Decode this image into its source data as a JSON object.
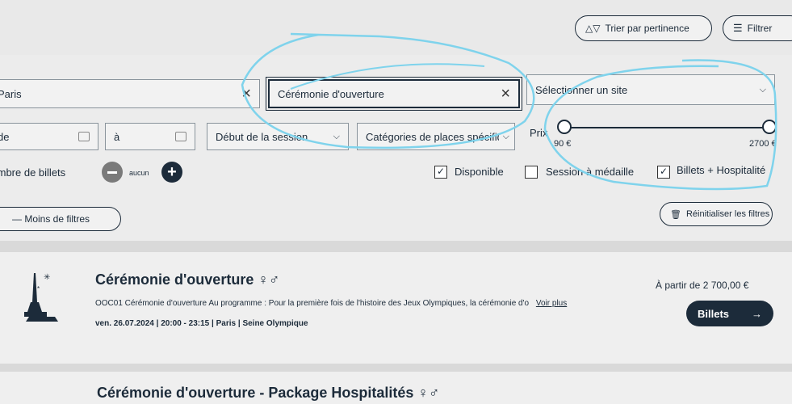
{
  "toolbar": {
    "sort_label": "Trier par pertinence",
    "filter_label": "Filtrer"
  },
  "filters": {
    "city_value": "Paris",
    "event_value": "Cérémonie d'ouverture",
    "site_placeholder": "Sélectionner un site",
    "date_from_placeholder": "de",
    "date_to_placeholder": "à",
    "session_start_label": "Début de la session",
    "seat_categories_label": "Catégories de places spécifiq",
    "price_label": "Prix",
    "price_min": "90 €",
    "price_max": "2700 €",
    "tickets_label": "Nombre de billets",
    "tickets_value": "aucun",
    "available_label": "Disponible",
    "available_checked": true,
    "medal_label": "Session à médaille",
    "medal_checked": false,
    "hospitality_label": "Billets + Hospitalité",
    "hospitality_checked": true,
    "less_filters_label": "— Moins de filtres",
    "reset_label": "Réinitialiser les filtres"
  },
  "results": [
    {
      "title": "Cérémonie d'ouverture",
      "gender_symbol": "♀♂",
      "description": "OOC01 Cérémonie d'ouverture Au programme : Pour la première fois de l'histoire des Jeux Olympiques, la cérémonie d'o",
      "more_link": "Voir plus",
      "date": "ven. 26.07.2024",
      "time": "20:00 - 23:15",
      "city": "Paris",
      "venue": "Seine Olympique",
      "price": "À partir de 2 700,00 €",
      "button_label": "Billets",
      "button_arrow": "→"
    },
    {
      "title": "Cérémonie d'ouverture - Package Hospitalités",
      "gender_symbol": "♀♂"
    }
  ],
  "colors": {
    "primary": "#1c2b3a",
    "annotation": "#7fd3ec",
    "minus_button": "#7a7a7a"
  }
}
